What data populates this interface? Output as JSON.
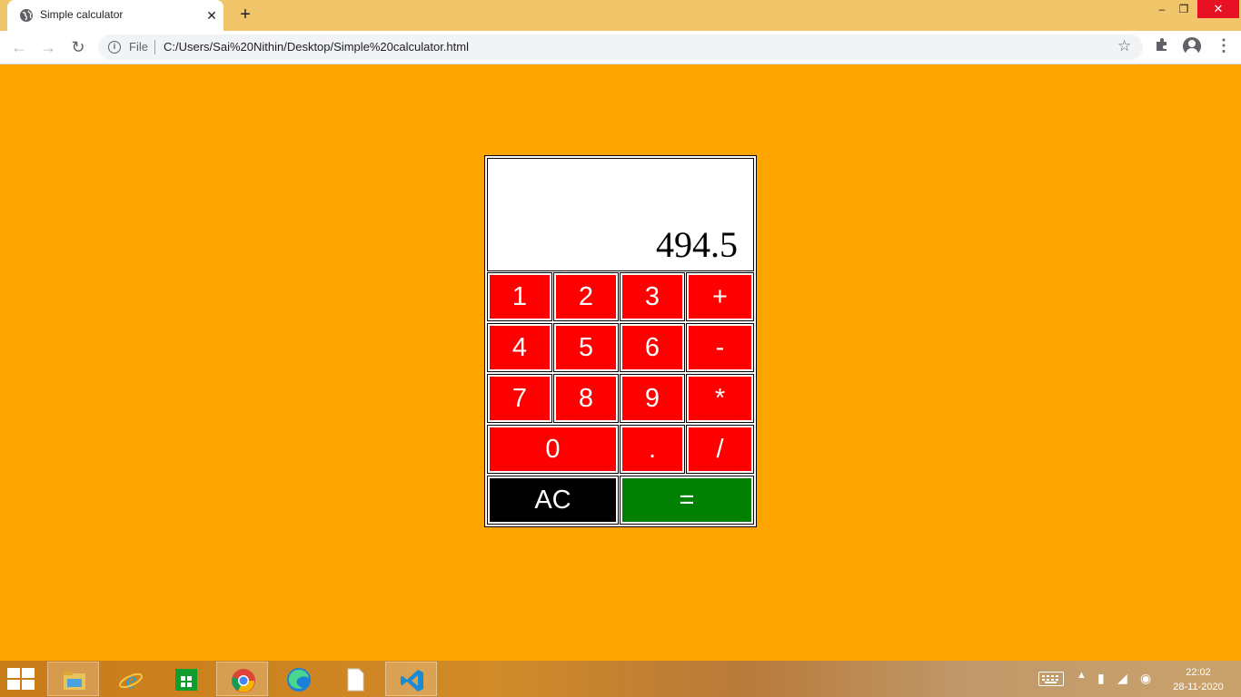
{
  "browser": {
    "tab_title": "Simple calculator",
    "tab_close": "✕",
    "new_tab": "+",
    "address_scheme": "File",
    "url": "C:/Users/Sai%20Nithin/Desktop/Simple%20calculator.html",
    "window_controls": {
      "minimize": "–",
      "maximize": "❐",
      "close": "✕"
    }
  },
  "calculator": {
    "display_value": "494.5",
    "keys": {
      "k1": "1",
      "k2": "2",
      "k3": "3",
      "plus": "+",
      "k4": "4",
      "k5": "5",
      "k6": "6",
      "minus": "-",
      "k7": "7",
      "k8": "8",
      "k9": "9",
      "multiply": "*",
      "k0": "0",
      "dot": ".",
      "divide": "/",
      "clear": "AC",
      "equals": "="
    },
    "colors": {
      "page_bg": "#ffa500",
      "key_bg": "#ff0000",
      "clear_bg": "#000000",
      "equals_bg": "#008000"
    }
  },
  "taskbar": {
    "clock_time": "22:02",
    "clock_date": "28-11-2020",
    "apps": [
      "start-icon",
      "file-explorer-icon",
      "internet-explorer-icon",
      "store-icon",
      "chrome-icon",
      "edge-icon",
      "notepad-icon",
      "vscode-icon"
    ]
  }
}
